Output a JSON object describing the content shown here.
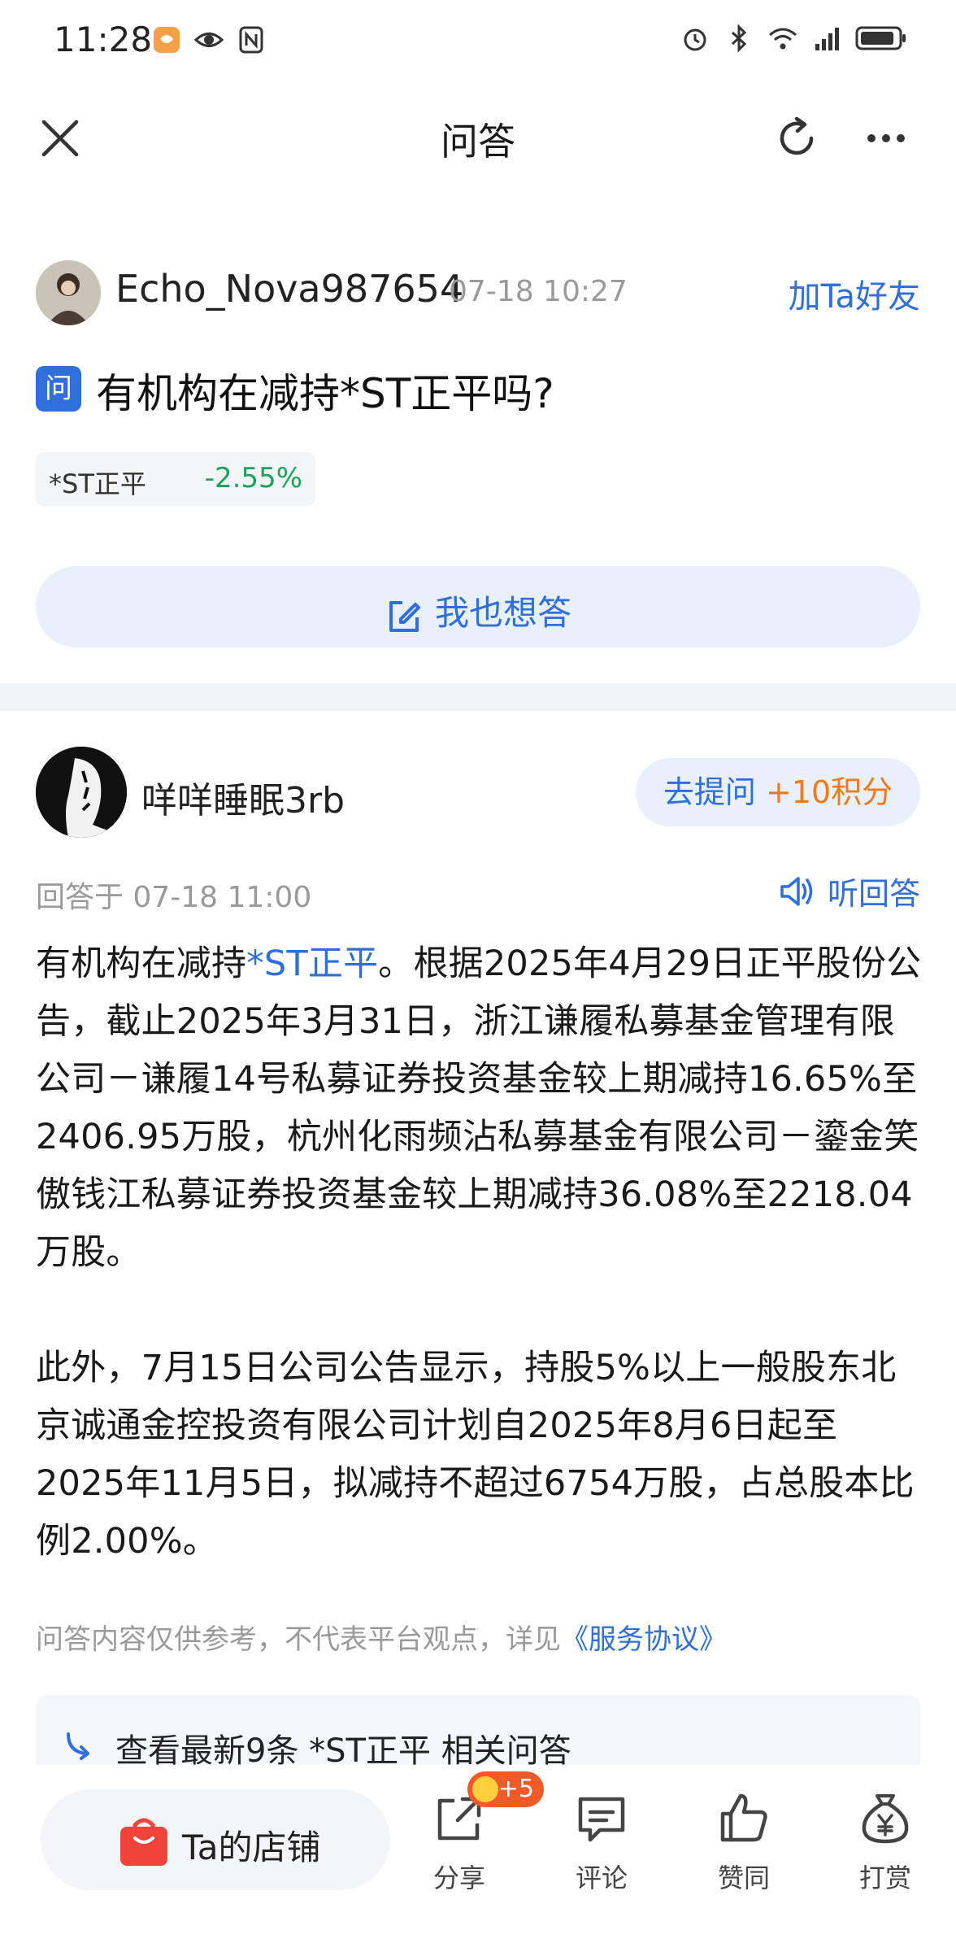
{
  "status_bar": {
    "time": "11:28"
  },
  "header": {
    "title": "问答"
  },
  "question": {
    "asker_name": "Echo_Nova987654",
    "asker_time": "07-18 10:27",
    "add_friend": "加Ta好友",
    "badge": "问",
    "text": "有机构在减持*ST正平吗?",
    "stock_name": "*ST正平",
    "stock_change": "-2.55%",
    "answer_too": "我也想答"
  },
  "answer": {
    "answerer_name": "咩咩睡眠3rb",
    "ask_label": "去提问",
    "ask_points": "+10积分",
    "time": "回答于 07-18 11:00",
    "listen": "听回答",
    "p1_prefix": "有机构在减持",
    "p1_link": "*ST正平",
    "p1_rest": "。根据2025年4月29日正平股份公告，截止2025年3月31日，浙江谦履私募基金管理有限公司－谦履14号私募证券投资基金较上期减持16.65%至2406.95万股，杭州化雨频沾私募基金有限公司－鎏金笑傲钱江私募证券投资基金较上期减持36.08%至2218.04万股。",
    "p2": "此外，7月15日公司公告显示，持股5%以上一般股东北京诚通金控投资有限公司计划自2025年8月6日起至2025年11月5日，拟减持不超过6754万股，占总股本比例2.00%。"
  },
  "disclaimer": {
    "text": "问答内容仅供参考，不代表平台观点，详见",
    "link": "《服务协议》"
  },
  "related": {
    "text": "查看最新9条 *ST正平 相关问答"
  },
  "bottom_bar": {
    "shop": "Ta的店铺",
    "share": "分享",
    "share_badge": "+5",
    "comment": "评论",
    "like": "赞同",
    "tip": "打赏"
  }
}
